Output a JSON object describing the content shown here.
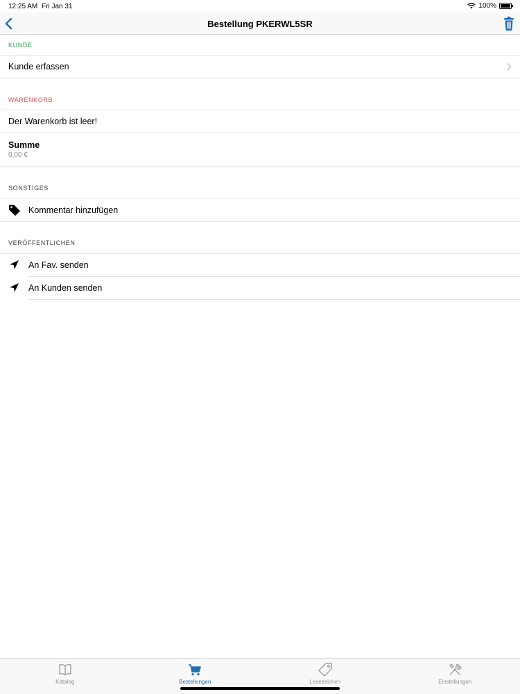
{
  "status_bar": {
    "time": "12:25 AM",
    "date": "Fri Jan 31",
    "battery": "100%"
  },
  "nav": {
    "title": "Bestellung PKERWL5SR",
    "back_icon": "chevron-left-icon",
    "trash_icon": "trash-icon",
    "accent_color": "#1f6fb3"
  },
  "sections": {
    "kunde": {
      "header": "KUNDE",
      "header_color": "#2bab43",
      "row_label": "Kunde erfassen"
    },
    "warenkorb": {
      "header": "WARENKORB",
      "header_color": "#e2514f",
      "empty_label": "Der Warenkorb ist leer!",
      "sum_title": "Summe",
      "sum_value": "0,00 €"
    },
    "sonstiges": {
      "header": "SONSTIGES",
      "comment_label": "Kommentar hinzufügen",
      "comment_icon": "tag-icon"
    },
    "veroeffentlichen": {
      "header": "VERÖFFENTLICHEN",
      "send_fav_label": "An Fav. senden",
      "send_customer_label": "An Kunden senden",
      "send_icon": "paper-plane-icon"
    }
  },
  "tabs": [
    {
      "label": "Katalog",
      "icon": "book-icon",
      "active": false
    },
    {
      "label": "Bestellungen",
      "icon": "cart-icon",
      "active": true
    },
    {
      "label": "Lesezeichen",
      "icon": "tag-icon",
      "active": false
    },
    {
      "label": "Einstellungen",
      "icon": "tools-icon",
      "active": false
    }
  ]
}
